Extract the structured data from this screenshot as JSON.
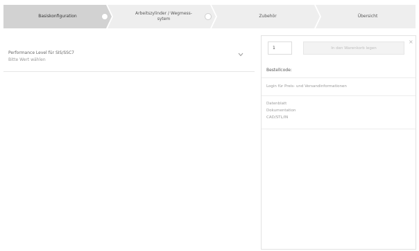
{
  "steps": [
    {
      "label": "Basiskonfiguration",
      "active": true
    },
    {
      "label_line1": "Arbeitszylinder / Wegmess-",
      "label_line2": "sytem",
      "active": false
    },
    {
      "label": "Zubehör",
      "active": false
    },
    {
      "label": "Übersicht",
      "active": false
    }
  ],
  "config": {
    "title": "Performance Level für SIS/SSC7",
    "value": "Bitte Wert wählen",
    "toggle_icon": "chevron-down-icon"
  },
  "order": {
    "quantity": "1",
    "cart_button_label": "In den Warenkorb legen",
    "close_icon": "close-icon",
    "order_code_label": "Bestellcode:",
    "login_text": "Login für Preis- und Versandinformationen",
    "links": [
      "Datenblatt",
      "Dokumentation",
      "CAD/STL/IN"
    ]
  },
  "colors": {
    "active_step": "#d2d2d2",
    "inactive_step": "#eeeeee",
    "border": "#e2e2e2"
  }
}
